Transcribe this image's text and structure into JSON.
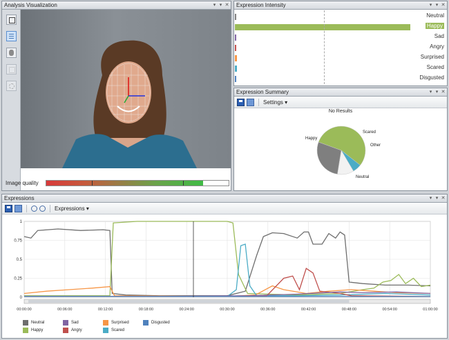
{
  "panels": {
    "analysis": {
      "title": "Analysis Visualization",
      "image_quality_label": "Image quality",
      "image_quality_value": 0.86
    },
    "intensity": {
      "title": "Expression Intensity"
    },
    "summary": {
      "title": "Expression Summary",
      "settings_label": "Settings",
      "no_results": "No Results"
    },
    "expressions": {
      "title": "Expressions",
      "menu_label": "Expressions"
    }
  },
  "window_buttons": [
    "▾",
    "▾",
    "✕"
  ],
  "intensity_rows": [
    {
      "label": "Neutral",
      "value": 0.0,
      "color": "#7f7f7f",
      "highlight": false
    },
    {
      "label": "Happy",
      "value": 0.97,
      "color": "#9bbb59",
      "highlight": true
    },
    {
      "label": "Sad",
      "value": 0.0,
      "color": "#8064a2",
      "highlight": false
    },
    {
      "label": "Angry",
      "value": 0.0,
      "color": "#c0504d",
      "highlight": false
    },
    {
      "label": "Surprised",
      "value": 0.01,
      "color": "#f79646",
      "highlight": false
    },
    {
      "label": "Scared",
      "value": 0.01,
      "color": "#4bacc6",
      "highlight": false
    },
    {
      "label": "Disgusted",
      "value": 0.0,
      "color": "#4f81bd",
      "highlight": false
    }
  ],
  "pie": {
    "labels": {
      "happy": "Happy",
      "scared": "Scared",
      "other": "Other",
      "neutral": "Neutral"
    },
    "slices": [
      {
        "name": "Happy",
        "value": 0.55,
        "color": "#9bbb59"
      },
      {
        "name": "Scared",
        "value": 0.06,
        "color": "#4bacc6"
      },
      {
        "name": "Other",
        "value": 0.11,
        "color": "#f2f2f2"
      },
      {
        "name": "Neutral",
        "value": 0.28,
        "color": "#7f7f7f"
      }
    ]
  },
  "chart_data": {
    "type": "line",
    "xlim": [
      0,
      3600
    ],
    "ylim": [
      0,
      1
    ],
    "y_ticks": [
      "0",
      "0.25",
      "0.5",
      "0.75",
      "1"
    ],
    "x_ticks": [
      "00:00:00",
      "00:06:00",
      "00:12:00",
      "00:18:00",
      "00:24:00",
      "00:30:00",
      "00:36:00",
      "00:42:00",
      "00:48:00",
      "00:54:00",
      "01:00:00"
    ],
    "cursor_x": 1500,
    "series": [
      {
        "name": "Neutral",
        "color": "#6e6e6e",
        "points": [
          [
            0,
            0.8
          ],
          [
            60,
            0.78
          ],
          [
            120,
            0.88
          ],
          [
            300,
            0.9
          ],
          [
            500,
            0.88
          ],
          [
            700,
            0.89
          ],
          [
            760,
            0.88
          ],
          [
            780,
            0.05
          ],
          [
            900,
            0.03
          ],
          [
            1200,
            0.02
          ],
          [
            1800,
            0.02
          ],
          [
            1960,
            0.08
          ],
          [
            2060,
            0.55
          ],
          [
            2120,
            0.8
          ],
          [
            2200,
            0.85
          ],
          [
            2300,
            0.84
          ],
          [
            2420,
            0.78
          ],
          [
            2480,
            0.86
          ],
          [
            2520,
            0.86
          ],
          [
            2560,
            0.7
          ],
          [
            2640,
            0.7
          ],
          [
            2700,
            0.84
          ],
          [
            2760,
            0.78
          ],
          [
            2800,
            0.86
          ],
          [
            2840,
            0.82
          ],
          [
            2880,
            0.2
          ],
          [
            3000,
            0.18
          ],
          [
            3200,
            0.16
          ],
          [
            3400,
            0.16
          ],
          [
            3600,
            0.15
          ]
        ]
      },
      {
        "name": "Happy",
        "color": "#9bbb59",
        "points": [
          [
            0,
            0.02
          ],
          [
            700,
            0.02
          ],
          [
            760,
            0.02
          ],
          [
            790,
            0.98
          ],
          [
            1000,
            1.0
          ],
          [
            1500,
            1.0
          ],
          [
            1800,
            1.0
          ],
          [
            1850,
            0.98
          ],
          [
            1900,
            0.3
          ],
          [
            1980,
            0.05
          ],
          [
            2400,
            0.03
          ],
          [
            2800,
            0.05
          ],
          [
            3000,
            0.1
          ],
          [
            3100,
            0.12
          ],
          [
            3180,
            0.2
          ],
          [
            3250,
            0.22
          ],
          [
            3320,
            0.3
          ],
          [
            3380,
            0.18
          ],
          [
            3450,
            0.25
          ],
          [
            3520,
            0.14
          ],
          [
            3600,
            0.16
          ]
        ]
      },
      {
        "name": "Surprised",
        "color": "#f79646",
        "points": [
          [
            0,
            0.05
          ],
          [
            200,
            0.08
          ],
          [
            400,
            0.1
          ],
          [
            600,
            0.12
          ],
          [
            760,
            0.14
          ],
          [
            800,
            0.02
          ],
          [
            1800,
            0.01
          ],
          [
            2050,
            0.03
          ],
          [
            2200,
            0.15
          ],
          [
            2300,
            0.1
          ],
          [
            2500,
            0.05
          ],
          [
            2700,
            0.08
          ],
          [
            2900,
            0.1
          ],
          [
            3100,
            0.08
          ],
          [
            3300,
            0.06
          ],
          [
            3600,
            0.05
          ]
        ]
      },
      {
        "name": "Scared",
        "color": "#4bacc6",
        "points": [
          [
            0,
            0.01
          ],
          [
            1800,
            0.01
          ],
          [
            1880,
            0.1
          ],
          [
            1920,
            0.68
          ],
          [
            1960,
            0.7
          ],
          [
            2000,
            0.15
          ],
          [
            2060,
            0.02
          ],
          [
            2400,
            0.02
          ],
          [
            2800,
            0.03
          ],
          [
            3200,
            0.05
          ],
          [
            3600,
            0.03
          ]
        ]
      },
      {
        "name": "Angry",
        "color": "#c0504d",
        "points": [
          [
            0,
            0.01
          ],
          [
            2000,
            0.01
          ],
          [
            2150,
            0.02
          ],
          [
            2300,
            0.25
          ],
          [
            2380,
            0.28
          ],
          [
            2440,
            0.1
          ],
          [
            2500,
            0.38
          ],
          [
            2560,
            0.32
          ],
          [
            2620,
            0.08
          ],
          [
            2800,
            0.05
          ],
          [
            2900,
            0.02
          ],
          [
            3600,
            0.01
          ]
        ]
      },
      {
        "name": "Sad",
        "color": "#8064a2",
        "points": [
          [
            0,
            0.01
          ],
          [
            1200,
            0.01
          ],
          [
            2000,
            0.02
          ],
          [
            2400,
            0.04
          ],
          [
            2800,
            0.07
          ],
          [
            3000,
            0.06
          ],
          [
            3300,
            0.07
          ],
          [
            3600,
            0.05
          ]
        ]
      },
      {
        "name": "Disgusted",
        "color": "#4f81bd",
        "points": [
          [
            0,
            0.01
          ],
          [
            3600,
            0.01
          ]
        ]
      }
    ],
    "legend": [
      {
        "name": "Neutral",
        "color": "#6e6e6e"
      },
      {
        "name": "Happy",
        "color": "#9bbb59"
      },
      {
        "name": "Sad",
        "color": "#8064a2"
      },
      {
        "name": "Angry",
        "color": "#c0504d"
      },
      {
        "name": "Surprised",
        "color": "#f79646"
      },
      {
        "name": "Scared",
        "color": "#4bacc6"
      },
      {
        "name": "Disgusted",
        "color": "#4f81bd"
      }
    ]
  }
}
